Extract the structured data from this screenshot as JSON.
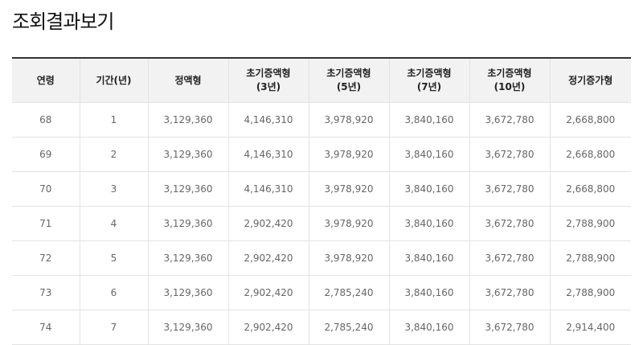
{
  "page": {
    "title": "조회결과보기"
  },
  "table": {
    "headers": [
      {
        "line1": "연령",
        "line2": ""
      },
      {
        "line1": "기간(년)",
        "line2": ""
      },
      {
        "line1": "정액형",
        "line2": ""
      },
      {
        "line1": "초기증액형",
        "line2": "(3년)"
      },
      {
        "line1": "초기증액형",
        "line2": "(5년)"
      },
      {
        "line1": "초기증액형",
        "line2": "(7년)"
      },
      {
        "line1": "초기증액형",
        "line2": "(10년)"
      },
      {
        "line1": "정기증가형",
        "line2": ""
      }
    ],
    "rows": [
      [
        "68",
        "1",
        "3,129,360",
        "4,146,310",
        "3,978,920",
        "3,840,160",
        "3,672,780",
        "2,668,800"
      ],
      [
        "69",
        "2",
        "3,129,360",
        "4,146,310",
        "3,978,920",
        "3,840,160",
        "3,672,780",
        "2,668,800"
      ],
      [
        "70",
        "3",
        "3,129,360",
        "4,146,310",
        "3,978,920",
        "3,840,160",
        "3,672,780",
        "2,668,800"
      ],
      [
        "71",
        "4",
        "3,129,360",
        "2,902,420",
        "3,978,920",
        "3,840,160",
        "3,672,780",
        "2,788,900"
      ],
      [
        "72",
        "5",
        "3,129,360",
        "2,902,420",
        "3,978,920",
        "3,840,160",
        "3,672,780",
        "2,788,900"
      ],
      [
        "73",
        "6",
        "3,129,360",
        "2,902,420",
        "2,785,240",
        "3,840,160",
        "3,672,780",
        "2,788,900"
      ],
      [
        "74",
        "7",
        "3,129,360",
        "2,902,420",
        "2,785,240",
        "3,840,160",
        "3,672,780",
        "2,914,400"
      ]
    ]
  },
  "colors": {
    "header_bg": "#f2f2f2",
    "top_border": "#333333",
    "cell_text": "#666666"
  }
}
